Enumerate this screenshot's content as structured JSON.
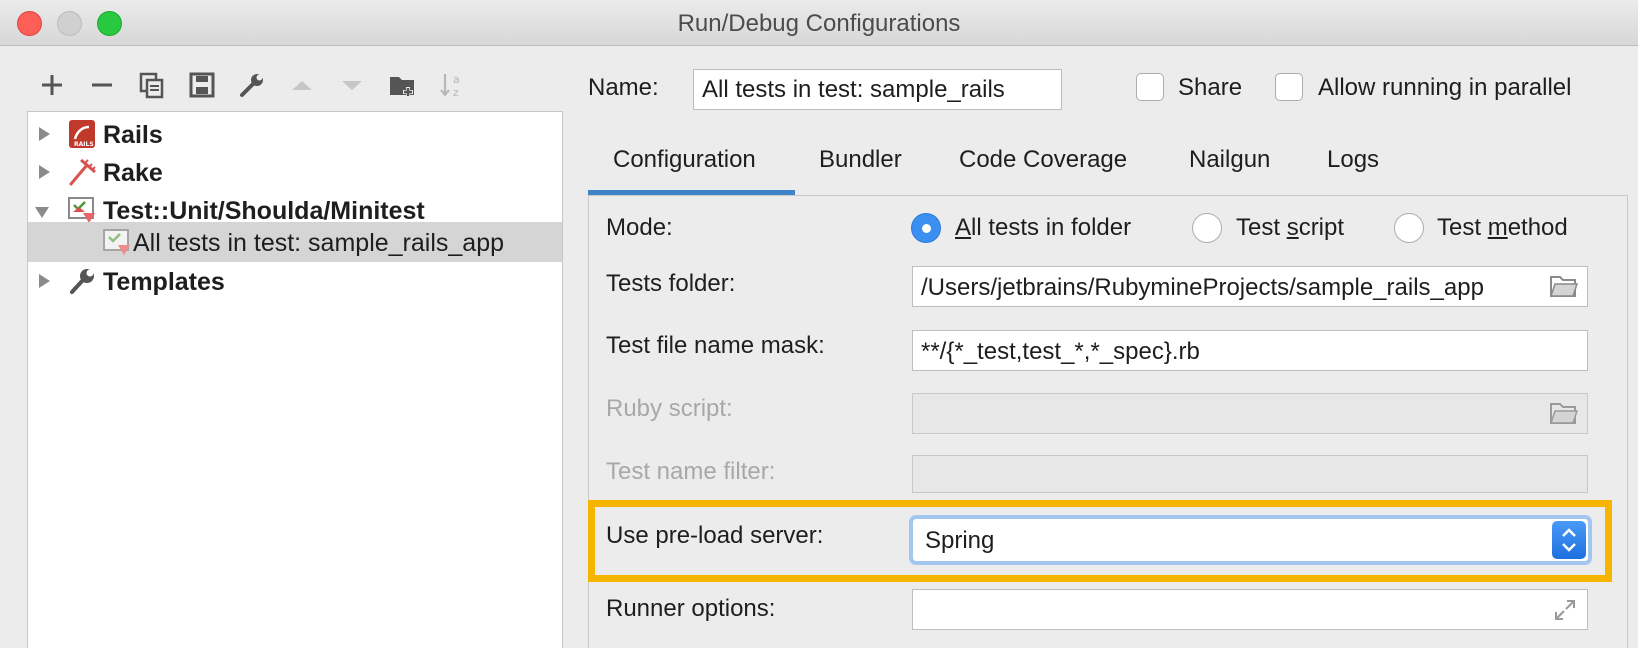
{
  "window": {
    "title": "Run/Debug Configurations"
  },
  "toolbar": {
    "buttons": [
      "add-icon",
      "remove-icon",
      "copy-icon",
      "save-icon",
      "wrench-icon",
      "move-up-icon",
      "move-down-icon",
      "new-folder-icon",
      "sort-icon"
    ]
  },
  "tree": {
    "items": [
      {
        "label": "Rails",
        "icon": "rails-icon",
        "expanded": false,
        "bold": true
      },
      {
        "label": "Rake",
        "icon": "rake-icon",
        "expanded": false,
        "bold": true
      },
      {
        "label": "Test::Unit/Shoulda/Minitest",
        "icon": "test-icon",
        "expanded": true,
        "bold": true
      },
      {
        "label": "All tests in test: sample_rails_app",
        "icon": "test-config-icon",
        "selected": true,
        "bold": false
      },
      {
        "label": "Templates",
        "icon": "wrench-icon",
        "expanded": false,
        "bold": true
      }
    ]
  },
  "header": {
    "name_label": "Name:",
    "name_value": "All tests in test: sample_rails",
    "share_label": "Share",
    "parallel_label": "Allow running in parallel"
  },
  "tabs": [
    {
      "label": "Configuration",
      "active": true
    },
    {
      "label": "Bundler"
    },
    {
      "label": "Code Coverage"
    },
    {
      "label": "Nailgun"
    },
    {
      "label": "Logs"
    }
  ],
  "form": {
    "mode_label": "Mode:",
    "mode_options": [
      {
        "prefix": "",
        "mnemonic": "A",
        "suffix": "ll tests in folder",
        "selected": true
      },
      {
        "prefix": "Test ",
        "mnemonic": "s",
        "suffix": "cript",
        "selected": false
      },
      {
        "prefix": "Test ",
        "mnemonic": "m",
        "suffix": "ethod",
        "selected": false
      }
    ],
    "tests_folder_label": "Tests folder:",
    "tests_folder_value": "/Users/jetbrains/RubymineProjects/sample_rails_app",
    "mask_label": "Test file name mask:",
    "mask_value": "**/{*_test,test_*,*_spec}.rb",
    "ruby_script_label": "Ruby script:",
    "ruby_script_value": "",
    "name_filter_label": "Test name filter:",
    "name_filter_value": "",
    "preload_label": "Use pre-load server:",
    "preload_value": "Spring",
    "runner_label": "Runner options:",
    "runner_value": ""
  },
  "colors": {
    "accent": "#3b8ff0",
    "highlight": "#f7b500",
    "selected_row": "#d5d5d5"
  }
}
